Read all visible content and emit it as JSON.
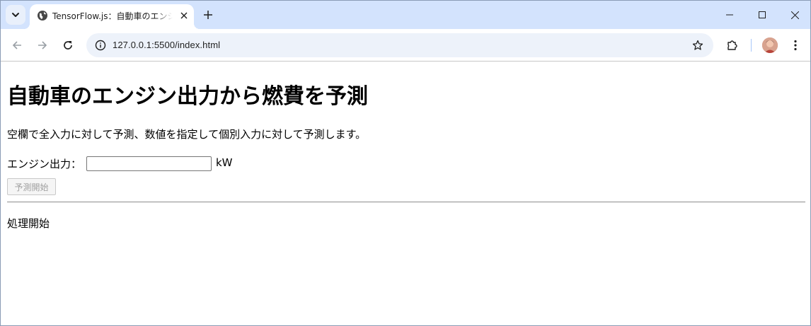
{
  "browser": {
    "tab_title": "TensorFlow.js：自動車のエンジン出力から燃費を予測",
    "url": "127.0.0.1:5500/index.html",
    "icons": {
      "tab_search": "chevron-down-icon",
      "favicon": "globe-icon",
      "tab_close": "close-icon",
      "new_tab": "plus-icon",
      "minimize": "minimize-icon",
      "maximize": "maximize-icon",
      "close_window": "close-icon",
      "back": "arrow-left-icon",
      "forward": "arrow-right-icon",
      "reload": "reload-icon",
      "site_info": "info-icon",
      "bookmark": "star-icon",
      "extensions": "puzzle-icon",
      "profile": "avatar",
      "menu": "more-vertical-icon"
    },
    "colors": {
      "tabstrip": "#d3e3fd",
      "omnibox": "#edf2fa"
    }
  },
  "page": {
    "title": "自動車のエンジン出力から燃費を予測",
    "description": "空欄で全入力に対して予測、数値を指定して個別入力に対して予測します。",
    "engine_label": "エンジン出力：",
    "engine_input_value": "",
    "unit": "kW",
    "predict_button": "予測開始",
    "status": "処理開始"
  }
}
